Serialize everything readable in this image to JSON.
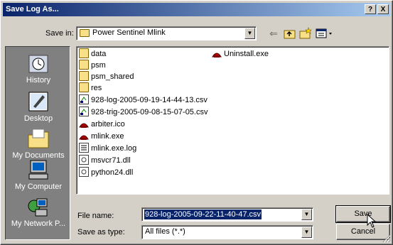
{
  "window": {
    "title": "Save Log As...",
    "help_button": "?",
    "close_button": "X"
  },
  "save_in": {
    "label": "Save in:",
    "value": "Power Sentinel Mlink"
  },
  "places": [
    {
      "label": "History",
      "icon": "history-icon"
    },
    {
      "label": "Desktop",
      "icon": "desktop-icon"
    },
    {
      "label": "My Documents",
      "icon": "my-documents-icon"
    },
    {
      "label": "My Computer",
      "icon": "my-computer-icon"
    },
    {
      "label": "My Network P...",
      "icon": "my-network-places-icon"
    }
  ],
  "files": [
    {
      "name": "data",
      "icon": "folder-icon"
    },
    {
      "name": "psm",
      "icon": "folder-icon"
    },
    {
      "name": "psm_shared",
      "icon": "folder-icon"
    },
    {
      "name": "res",
      "icon": "folder-icon"
    },
    {
      "name": "928-log-2005-09-19-14-44-13.csv",
      "icon": "csv-file-icon"
    },
    {
      "name": "928-trig-2005-09-08-15-07-05.csv",
      "icon": "csv-file-icon"
    },
    {
      "name": "arbiter.ico",
      "icon": "app-icon"
    },
    {
      "name": "mlink.exe",
      "icon": "app-icon"
    },
    {
      "name": "mlink.exe.log",
      "icon": "text-file-icon"
    },
    {
      "name": "msvcr71.dll",
      "icon": "dll-file-icon"
    },
    {
      "name": "python24.dll",
      "icon": "dll-file-icon"
    },
    {
      "name": "Uninstall.exe",
      "icon": "app-icon"
    }
  ],
  "file_name": {
    "label": "File name:",
    "value": "928-log-2005-09-22-11-40-47.csv"
  },
  "save_as_type": {
    "label": "Save as type:",
    "value": "All files (*.*)"
  },
  "buttons": {
    "save": "Save",
    "cancel": "Cancel"
  },
  "colors": {
    "title_gradient_start": "#0a246a",
    "title_gradient_end": "#a6caf0",
    "selection": "#0a246a",
    "face": "#d4d0c8"
  }
}
